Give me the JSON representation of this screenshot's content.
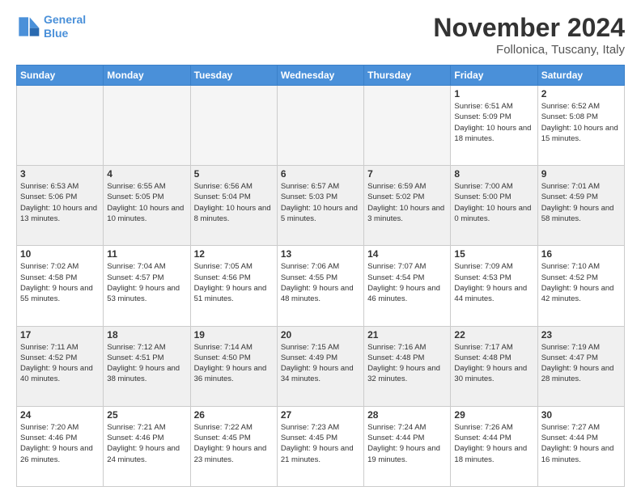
{
  "logo": {
    "line1": "General",
    "line2": "Blue"
  },
  "title": "November 2024",
  "location": "Follonica, Tuscany, Italy",
  "headers": [
    "Sunday",
    "Monday",
    "Tuesday",
    "Wednesday",
    "Thursday",
    "Friday",
    "Saturday"
  ],
  "weeks": [
    [
      {
        "day": "",
        "info": ""
      },
      {
        "day": "",
        "info": ""
      },
      {
        "day": "",
        "info": ""
      },
      {
        "day": "",
        "info": ""
      },
      {
        "day": "",
        "info": ""
      },
      {
        "day": "1",
        "sunrise": "Sunrise: 6:51 AM",
        "sunset": "Sunset: 5:09 PM",
        "daylight": "Daylight: 10 hours and 18 minutes."
      },
      {
        "day": "2",
        "sunrise": "Sunrise: 6:52 AM",
        "sunset": "Sunset: 5:08 PM",
        "daylight": "Daylight: 10 hours and 15 minutes."
      }
    ],
    [
      {
        "day": "3",
        "sunrise": "Sunrise: 6:53 AM",
        "sunset": "Sunset: 5:06 PM",
        "daylight": "Daylight: 10 hours and 13 minutes."
      },
      {
        "day": "4",
        "sunrise": "Sunrise: 6:55 AM",
        "sunset": "Sunset: 5:05 PM",
        "daylight": "Daylight: 10 hours and 10 minutes."
      },
      {
        "day": "5",
        "sunrise": "Sunrise: 6:56 AM",
        "sunset": "Sunset: 5:04 PM",
        "daylight": "Daylight: 10 hours and 8 minutes."
      },
      {
        "day": "6",
        "sunrise": "Sunrise: 6:57 AM",
        "sunset": "Sunset: 5:03 PM",
        "daylight": "Daylight: 10 hours and 5 minutes."
      },
      {
        "day": "7",
        "sunrise": "Sunrise: 6:59 AM",
        "sunset": "Sunset: 5:02 PM",
        "daylight": "Daylight: 10 hours and 3 minutes."
      },
      {
        "day": "8",
        "sunrise": "Sunrise: 7:00 AM",
        "sunset": "Sunset: 5:00 PM",
        "daylight": "Daylight: 10 hours and 0 minutes."
      },
      {
        "day": "9",
        "sunrise": "Sunrise: 7:01 AM",
        "sunset": "Sunset: 4:59 PM",
        "daylight": "Daylight: 9 hours and 58 minutes."
      }
    ],
    [
      {
        "day": "10",
        "sunrise": "Sunrise: 7:02 AM",
        "sunset": "Sunset: 4:58 PM",
        "daylight": "Daylight: 9 hours and 55 minutes."
      },
      {
        "day": "11",
        "sunrise": "Sunrise: 7:04 AM",
        "sunset": "Sunset: 4:57 PM",
        "daylight": "Daylight: 9 hours and 53 minutes."
      },
      {
        "day": "12",
        "sunrise": "Sunrise: 7:05 AM",
        "sunset": "Sunset: 4:56 PM",
        "daylight": "Daylight: 9 hours and 51 minutes."
      },
      {
        "day": "13",
        "sunrise": "Sunrise: 7:06 AM",
        "sunset": "Sunset: 4:55 PM",
        "daylight": "Daylight: 9 hours and 48 minutes."
      },
      {
        "day": "14",
        "sunrise": "Sunrise: 7:07 AM",
        "sunset": "Sunset: 4:54 PM",
        "daylight": "Daylight: 9 hours and 46 minutes."
      },
      {
        "day": "15",
        "sunrise": "Sunrise: 7:09 AM",
        "sunset": "Sunset: 4:53 PM",
        "daylight": "Daylight: 9 hours and 44 minutes."
      },
      {
        "day": "16",
        "sunrise": "Sunrise: 7:10 AM",
        "sunset": "Sunset: 4:52 PM",
        "daylight": "Daylight: 9 hours and 42 minutes."
      }
    ],
    [
      {
        "day": "17",
        "sunrise": "Sunrise: 7:11 AM",
        "sunset": "Sunset: 4:52 PM",
        "daylight": "Daylight: 9 hours and 40 minutes."
      },
      {
        "day": "18",
        "sunrise": "Sunrise: 7:12 AM",
        "sunset": "Sunset: 4:51 PM",
        "daylight": "Daylight: 9 hours and 38 minutes."
      },
      {
        "day": "19",
        "sunrise": "Sunrise: 7:14 AM",
        "sunset": "Sunset: 4:50 PM",
        "daylight": "Daylight: 9 hours and 36 minutes."
      },
      {
        "day": "20",
        "sunrise": "Sunrise: 7:15 AM",
        "sunset": "Sunset: 4:49 PM",
        "daylight": "Daylight: 9 hours and 34 minutes."
      },
      {
        "day": "21",
        "sunrise": "Sunrise: 7:16 AM",
        "sunset": "Sunset: 4:48 PM",
        "daylight": "Daylight: 9 hours and 32 minutes."
      },
      {
        "day": "22",
        "sunrise": "Sunrise: 7:17 AM",
        "sunset": "Sunset: 4:48 PM",
        "daylight": "Daylight: 9 hours and 30 minutes."
      },
      {
        "day": "23",
        "sunrise": "Sunrise: 7:19 AM",
        "sunset": "Sunset: 4:47 PM",
        "daylight": "Daylight: 9 hours and 28 minutes."
      }
    ],
    [
      {
        "day": "24",
        "sunrise": "Sunrise: 7:20 AM",
        "sunset": "Sunset: 4:46 PM",
        "daylight": "Daylight: 9 hours and 26 minutes."
      },
      {
        "day": "25",
        "sunrise": "Sunrise: 7:21 AM",
        "sunset": "Sunset: 4:46 PM",
        "daylight": "Daylight: 9 hours and 24 minutes."
      },
      {
        "day": "26",
        "sunrise": "Sunrise: 7:22 AM",
        "sunset": "Sunset: 4:45 PM",
        "daylight": "Daylight: 9 hours and 23 minutes."
      },
      {
        "day": "27",
        "sunrise": "Sunrise: 7:23 AM",
        "sunset": "Sunset: 4:45 PM",
        "daylight": "Daylight: 9 hours and 21 minutes."
      },
      {
        "day": "28",
        "sunrise": "Sunrise: 7:24 AM",
        "sunset": "Sunset: 4:44 PM",
        "daylight": "Daylight: 9 hours and 19 minutes."
      },
      {
        "day": "29",
        "sunrise": "Sunrise: 7:26 AM",
        "sunset": "Sunset: 4:44 PM",
        "daylight": "Daylight: 9 hours and 18 minutes."
      },
      {
        "day": "30",
        "sunrise": "Sunrise: 7:27 AM",
        "sunset": "Sunset: 4:44 PM",
        "daylight": "Daylight: 9 hours and 16 minutes."
      }
    ]
  ]
}
